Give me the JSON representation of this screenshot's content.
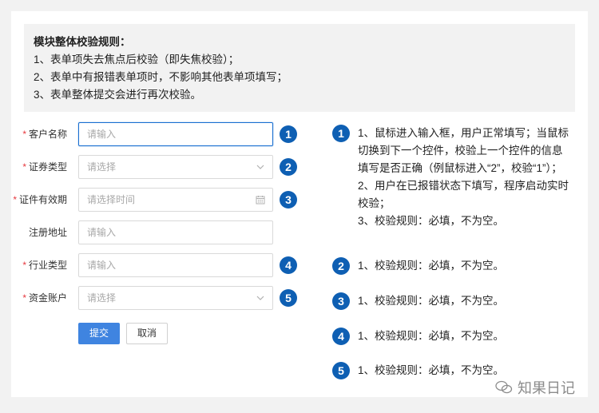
{
  "rules": {
    "title": "模块整体校验规则：",
    "lines": [
      "1、表单项失去焦点后校验（即失焦校验）；",
      "2、表单中有报错表单项时，不影响其他表单项填写；",
      "3、表单整体提交会进行再次校验。"
    ]
  },
  "form": {
    "required_mark": "*",
    "fields": [
      {
        "label": "客户名称",
        "required": true,
        "placeholder": "请输入",
        "type": "text",
        "badge": "1",
        "focused": true
      },
      {
        "label": "证券类型",
        "required": true,
        "placeholder": "请选择",
        "type": "select",
        "badge": "2"
      },
      {
        "label": "证件有效期",
        "required": true,
        "placeholder": "请选择时间",
        "type": "date",
        "badge": "3"
      },
      {
        "label": "注册地址",
        "required": false,
        "placeholder": "请输入",
        "type": "text",
        "badge": ""
      },
      {
        "label": "行业类型",
        "required": true,
        "placeholder": "请输入",
        "type": "text",
        "badge": "4"
      },
      {
        "label": "资金账户",
        "required": true,
        "placeholder": "请选择",
        "type": "select",
        "badge": "5"
      }
    ],
    "submit_label": "提交",
    "cancel_label": "取消"
  },
  "notes": [
    {
      "badge": "1",
      "lines": [
        "1、鼠标进入输入框，用户正常填写；当鼠标切换到下一个控件，校验上一个控件的信息填写是否正确（例鼠标进入“2”，校验“1”）；",
        "2、用户在已报错状态下填写，程序启动实时校验；",
        "3、校验规则：必填，不为空。"
      ]
    },
    {
      "badge": "2",
      "lines": [
        "1、校验规则：必填，不为空。"
      ]
    },
    {
      "badge": "3",
      "lines": [
        "1、校验规则：必填，不为空。"
      ]
    },
    {
      "badge": "4",
      "lines": [
        "1、校验规则：必填，不为空。"
      ]
    },
    {
      "badge": "5",
      "lines": [
        "1、校验规则：必填，不为空。"
      ]
    }
  ],
  "watermark": "知果日记",
  "colors": {
    "badge": "#0e5fb3",
    "primary": "#3f84e0",
    "required": "#e6393f",
    "focus": "#1a6fd1"
  },
  "icons": {
    "select": "chevron-down-icon",
    "date": "calendar-icon"
  }
}
